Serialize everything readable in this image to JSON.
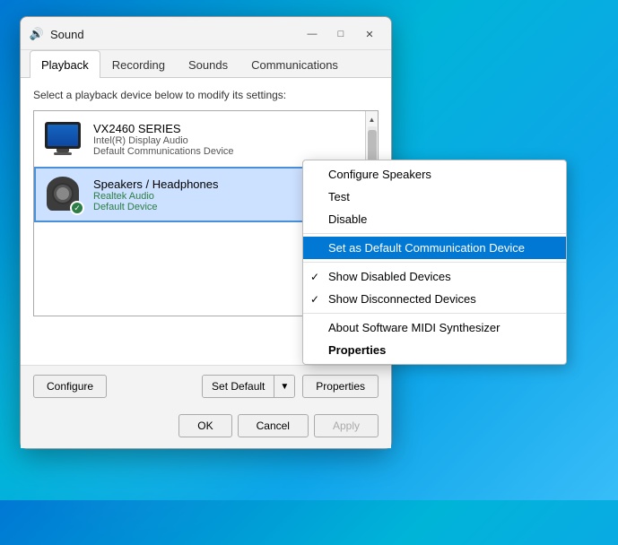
{
  "window": {
    "title": "Sound",
    "icon": "🔊"
  },
  "tabs": [
    {
      "id": "playback",
      "label": "Playback",
      "active": true
    },
    {
      "id": "recording",
      "label": "Recording",
      "active": false
    },
    {
      "id": "sounds",
      "label": "Sounds",
      "active": false
    },
    {
      "id": "communications",
      "label": "Communications",
      "active": false
    }
  ],
  "content": {
    "instruction": "Select a playback device below to modify its settings:"
  },
  "devices": [
    {
      "id": "vx2460",
      "name": "VX2460 SERIES",
      "sub1": "Intel(R) Display Audio",
      "sub2": "Default Communications Device",
      "type": "monitor",
      "selected": false,
      "has_badge": false
    },
    {
      "id": "speakers",
      "name": "Speakers / Headphones",
      "sub1": "Realtek Audio",
      "sub2": "Default Device",
      "type": "speaker",
      "selected": true,
      "has_badge": true
    }
  ],
  "buttons": {
    "configure": "Configure",
    "set_default": "Set Default",
    "properties": "Properties"
  },
  "action_buttons": {
    "ok": "OK",
    "cancel": "Cancel",
    "apply": "Apply"
  },
  "context_menu": {
    "items": [
      {
        "id": "configure",
        "label": "Configure Speakers",
        "checked": false,
        "highlighted": false,
        "bold": false
      },
      {
        "id": "test",
        "label": "Test",
        "checked": false,
        "highlighted": false,
        "bold": false
      },
      {
        "id": "disable",
        "label": "Disable",
        "checked": false,
        "highlighted": false,
        "bold": false
      },
      {
        "id": "set-default-comm",
        "label": "Set as Default Communication Device",
        "checked": false,
        "highlighted": true,
        "bold": false
      },
      {
        "id": "show-disabled",
        "label": "Show Disabled Devices",
        "checked": true,
        "highlighted": false,
        "bold": false
      },
      {
        "id": "show-disconnected",
        "label": "Show Disconnected Devices",
        "checked": true,
        "highlighted": false,
        "bold": false
      },
      {
        "id": "about-midi",
        "label": "About Software MIDI Synthesizer",
        "checked": false,
        "highlighted": false,
        "bold": false
      },
      {
        "id": "properties",
        "label": "Properties",
        "checked": false,
        "highlighted": false,
        "bold": true
      }
    ]
  }
}
